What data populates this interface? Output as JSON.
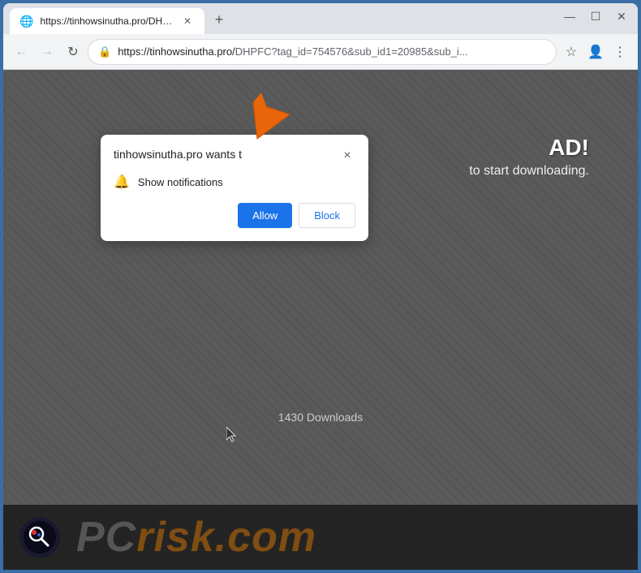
{
  "browser": {
    "tabs": [
      {
        "id": "tab-1",
        "title": "https://tinhowsinutha.pro/DHPF...",
        "url": "https://tinhowsinutha.pro/DHPFC?tag_id=754576&sub_id1=20985&sub_i...",
        "active": true,
        "favicon": "globe"
      }
    ],
    "new_tab_label": "+",
    "window_controls": {
      "minimize": "—",
      "maximize": "☐",
      "close": "✕"
    },
    "nav": {
      "back_label": "←",
      "forward_label": "→",
      "refresh_label": "↻"
    },
    "address_bar": {
      "domain": "https://tinhowsinutha.pro/",
      "path": "DHPFC?tag_id=754576&sub_id1=20985&sub_i...",
      "lock_icon": "🔒"
    },
    "toolbar_icons": {
      "star": "☆",
      "profile": "👤",
      "menu": "⋮"
    }
  },
  "notification_popup": {
    "title": "tinhowsinutha.pro wants t",
    "close_label": "×",
    "notification_icon": "🔔",
    "notification_text": "Show notifications",
    "allow_label": "Allow",
    "block_label": "Block"
  },
  "page": {
    "headline": "AD!",
    "subtext": "to start downloading.",
    "downloads_count": "1430 Downloads"
  },
  "watermark": {
    "text_pc": "PC",
    "text_risk": "risk",
    "text_com": ".com"
  }
}
